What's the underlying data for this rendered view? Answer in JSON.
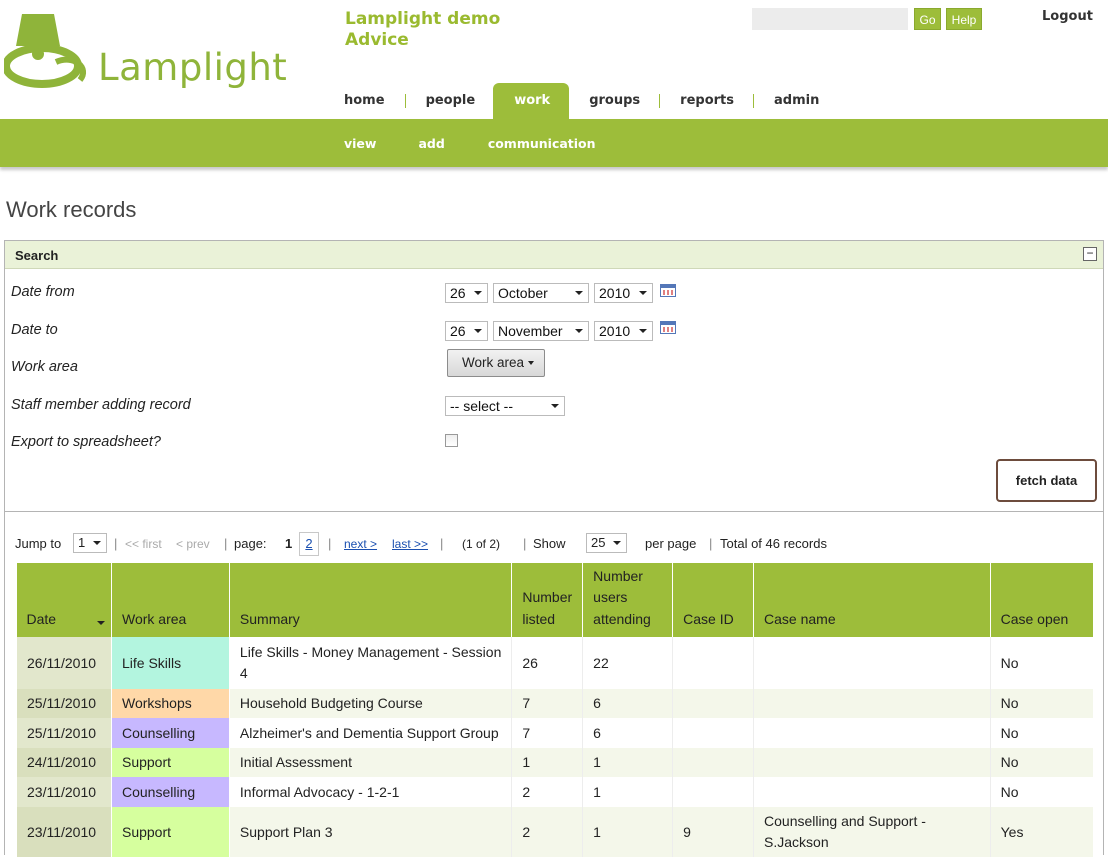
{
  "brand": {
    "name": "Lamplight",
    "org_line1": "Lamplight demo",
    "org_line2": "Advice",
    "logo_color": "#8fb43a"
  },
  "top": {
    "search_value": "",
    "go_label": "Go",
    "help_label": "Help",
    "logout_label": "Logout"
  },
  "nav": {
    "tabs": [
      {
        "label": "home"
      },
      {
        "label": "people"
      },
      {
        "label": "work",
        "active": true
      },
      {
        "label": "groups"
      },
      {
        "label": "reports"
      },
      {
        "label": "admin"
      }
    ],
    "sub": [
      {
        "label": "view"
      },
      {
        "label": "add"
      },
      {
        "label": "communication"
      }
    ],
    "accent": "#9dbd3a"
  },
  "page": {
    "title": "Work records"
  },
  "search": {
    "title": "Search",
    "collapse_icon": "minus-icon",
    "date_from": {
      "label": "Date from",
      "day": "26",
      "month": "October",
      "year": "2010"
    },
    "date_to": {
      "label": "Date to",
      "day": "26",
      "month": "November",
      "year": "2010"
    },
    "work_area": {
      "label": "Work area",
      "button": "Work area"
    },
    "staff": {
      "label": "Staff member adding record",
      "value": "-- select --"
    },
    "export": {
      "label": "Export to spreadsheet?",
      "checked": false
    },
    "fetch_label": "fetch data"
  },
  "pager": {
    "jump_label": "Jump to",
    "jump_value": "1",
    "first": "<< first",
    "prev": "< prev",
    "page_label": "page:",
    "current_page": "1",
    "other_page": "2",
    "next": "next >",
    "last": "last >>",
    "position": "(1 of 2)",
    "show_label": "Show",
    "show_value": "25",
    "per_page_label": "per page",
    "total": "Total of 46 records"
  },
  "table": {
    "headers": [
      "Date",
      "Work area",
      "Summary",
      "Number listed",
      "Number users attending",
      "Case ID",
      "Case name",
      "Case open"
    ],
    "rows": [
      {
        "date": "26/11/2010",
        "area": "Life Skills",
        "area_color": "#b3f5df",
        "summary": "Life Skills - Money Management - Session 4",
        "listed": "26",
        "attending": "22",
        "case_id": "",
        "case_name": "",
        "open": "No"
      },
      {
        "date": "25/11/2010",
        "area": "Workshops",
        "area_color": "#ffd8a8",
        "summary": "Household Budgeting Course",
        "listed": "7",
        "attending": "6",
        "case_id": "",
        "case_name": "",
        "open": "No"
      },
      {
        "date": "25/11/2010",
        "area": "Counselling",
        "area_color": "#c7b8ff",
        "summary": "Alzheimer's and Dementia Support Group",
        "listed": "7",
        "attending": "6",
        "case_id": "",
        "case_name": "",
        "open": "No"
      },
      {
        "date": "24/11/2010",
        "area": "Support",
        "area_color": "#d6ff9e",
        "summary": "Initial Assessment",
        "listed": "1",
        "attending": "1",
        "case_id": "",
        "case_name": "",
        "open": "No"
      },
      {
        "date": "23/11/2010",
        "area": "Counselling",
        "area_color": "#c7b8ff",
        "summary": "Informal Advocacy - 1-2-1",
        "listed": "2",
        "attending": "1",
        "case_id": "",
        "case_name": "",
        "open": "No"
      },
      {
        "date": "23/11/2010",
        "area": "Support",
        "area_color": "#d6ff9e",
        "summary": "Support Plan 3",
        "listed": "2",
        "attending": "1",
        "case_id": "9",
        "case_name": "Counselling and Support - S.Jackson",
        "open": "Yes"
      }
    ]
  }
}
